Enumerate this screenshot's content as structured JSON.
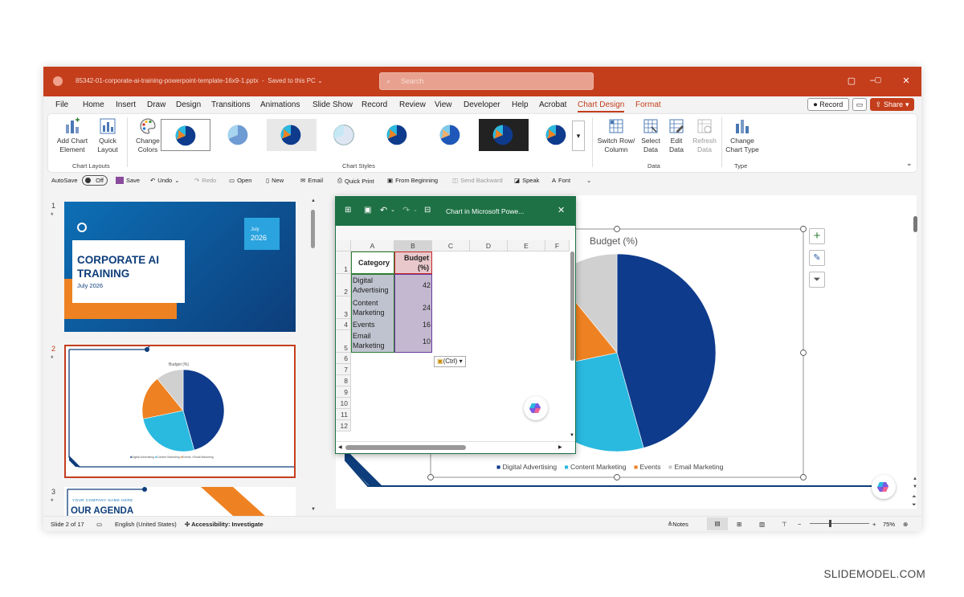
{
  "app": {
    "filename": "85342-01-corporate-ai-training-powerpoint-template-16x9-1.pptx",
    "save_status": "Saved to this PC",
    "search_placeholder": "Search"
  },
  "menu": [
    "File",
    "Home",
    "Insert",
    "Draw",
    "Design",
    "Transitions",
    "Animations",
    "Slide Show",
    "Record",
    "Review",
    "View",
    "Developer",
    "Help",
    "Acrobat",
    "Chart Design",
    "Format"
  ],
  "menu_active": "Chart Design",
  "actions": {
    "record": "Record",
    "share": "Share"
  },
  "ribbon": {
    "add_chart_element": "Add Chart Element",
    "quick_layout": "Quick Layout",
    "group_chart_layouts": "Chart Layouts",
    "change_colors": "Change Colors",
    "group_chart_styles": "Chart Styles",
    "switch_row_column": "Switch Row/ Column",
    "select_data": "Select Data",
    "edit_data": "Edit Data",
    "refresh_data": "Refresh Data",
    "group_data": "Data",
    "change_chart_type": "Change Chart Type",
    "group_type": "Type"
  },
  "qat": {
    "autosave": "AutoSave",
    "toggle": "Off",
    "save": "Save",
    "undo": "Undo",
    "redo": "Redo",
    "open": "Open",
    "new": "New",
    "email": "Email",
    "quick_print": "Quick Print",
    "from_beginning": "From Beginning",
    "send_backward": "Send Backward",
    "speak": "Speak",
    "font": "Font"
  },
  "slides": {
    "s1": {
      "num": "1",
      "title": "CORPORATE AI TRAINING",
      "date": "July 2026",
      "badge_top": "July",
      "badge_year": "2026"
    },
    "s2": {
      "num": "2",
      "chart_title": "Budget (%)",
      "legend": [
        "Digital Advertising",
        "Content Marketing",
        "Events",
        "Email Marketing"
      ]
    },
    "s3": {
      "num": "3",
      "subtitle": "YOUR COMPANY NAME HERE",
      "title": "OUR AGENDA"
    }
  },
  "excel": {
    "title": "Chart in Microsoft Powe...",
    "columns": [
      "A",
      "B",
      "C",
      "D",
      "E",
      "F"
    ],
    "header_category": "Category",
    "header_budget": "Budget (%)",
    "rows": [
      {
        "n": "1"
      },
      {
        "n": "2",
        "cat": "Digital Advertising",
        "val": "42"
      },
      {
        "n": "3",
        "cat": "Content Marketing",
        "val": "24"
      },
      {
        "n": "4",
        "cat": "Events",
        "val": "16"
      },
      {
        "n": "5",
        "cat": "Email Marketing",
        "val": "10"
      },
      {
        "n": "6"
      },
      {
        "n": "7"
      },
      {
        "n": "8"
      },
      {
        "n": "9"
      },
      {
        "n": "10"
      },
      {
        "n": "11"
      },
      {
        "n": "12"
      }
    ],
    "paste_options": "(Ctrl)"
  },
  "chart_data": {
    "type": "pie",
    "title": "Budget (%)",
    "categories": [
      "Digital Advertising",
      "Content Marketing",
      "Events",
      "Email Marketing"
    ],
    "values": [
      42,
      24,
      16,
      10
    ],
    "colors": [
      "#0e3b8c",
      "#2ab9df",
      "#ee8222",
      "#d0d0d0"
    ],
    "legend_position": "bottom"
  },
  "status": {
    "slide": "Slide 2 of 17",
    "language": "English (United States)",
    "accessibility": "Accessibility: Investigate",
    "notes": "Notes",
    "zoom": "75%"
  },
  "watermark": "SLIDEMODEL.COM"
}
